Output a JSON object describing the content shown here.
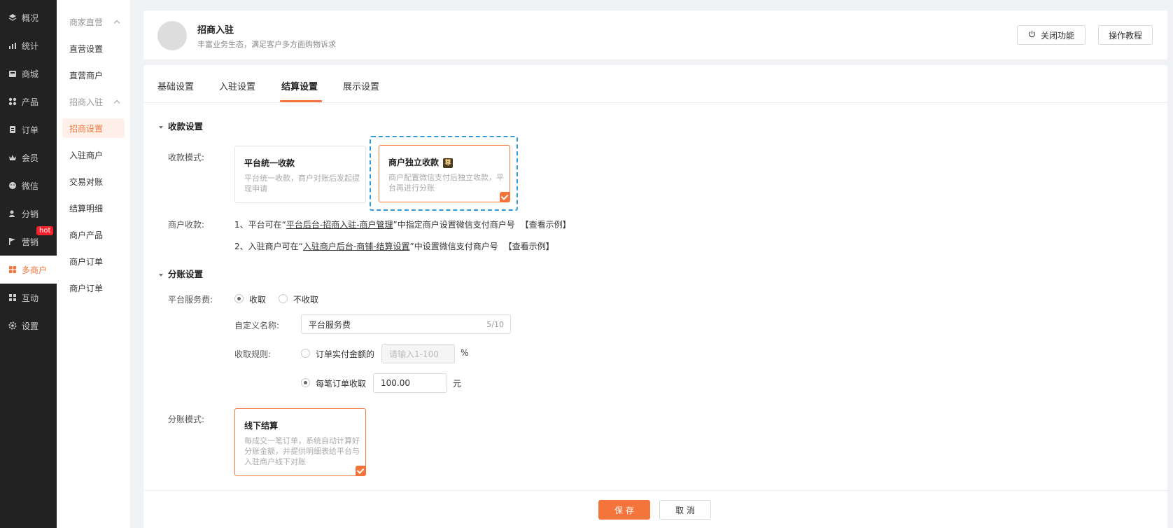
{
  "nav": {
    "items": [
      {
        "label": "概况",
        "icon": "layers-icon"
      },
      {
        "label": "统计",
        "icon": "chart-icon"
      },
      {
        "label": "商城",
        "icon": "store-icon"
      },
      {
        "label": "产品",
        "icon": "grid-icon"
      },
      {
        "label": "订单",
        "icon": "clipboard-icon"
      },
      {
        "label": "会员",
        "icon": "crown-icon"
      },
      {
        "label": "微信",
        "icon": "chat-icon"
      },
      {
        "label": "分销",
        "icon": "user-share-icon"
      },
      {
        "label": "营销",
        "icon": "flag-icon",
        "badge": "hot"
      },
      {
        "label": "多商户",
        "icon": "multi-store-icon"
      },
      {
        "label": "互动",
        "icon": "interact-icon"
      },
      {
        "label": "设置",
        "icon": "gear-icon"
      }
    ]
  },
  "submenu": {
    "group1": "商家直营",
    "group1_items": [
      "直营设置",
      "直营商户"
    ],
    "group2": "招商入驻",
    "group2_items": [
      "招商设置",
      "入驻商户",
      "交易对账",
      "结算明细",
      "商户产品",
      "商户订单",
      "商户订单"
    ]
  },
  "header": {
    "title": "招商入驻",
    "subtitle": "丰富业务生态，满足客户多方面购物诉求",
    "power_button": "关闭功能",
    "tutorial_button": "操作教程"
  },
  "tabs": [
    "基础设置",
    "入驻设置",
    "结算设置",
    "展示设置"
  ],
  "collect": {
    "section_title": "收款设置",
    "mode_label": "收款模式:",
    "card1_title": "平台统一收款",
    "card1_desc": "平台统一收款，商户对账后发起提现申请",
    "card2_title": "商户独立收款",
    "card2_badge": "尊",
    "card2_desc": "商户配置微信支付后独立收款，平台再进行分账",
    "merchant_label": "商户收款:",
    "line1_prefix": "1、平台可在“",
    "line1_link": "平台后台-招商入驻-商户管理",
    "line1_suffix": "”中指定商户设置微信支付商户号",
    "line1_example": "【查看示例】",
    "line2_prefix": "2、入驻商户可在“",
    "line2_link": "入驻商户后台-商铺-结算设置",
    "line2_suffix": "”中设置微信支付商户号",
    "line2_example": "【查看示例】"
  },
  "split": {
    "section_title": "分账设置",
    "fee_label": "平台服务费:",
    "opt_collect": "收取",
    "opt_no_collect": "不收取",
    "custom_name_label": "自定义名称:",
    "custom_name_value": "平台服务费",
    "custom_name_counter": "5/10",
    "rule_label": "收取规则:",
    "rule_opt1": "订单实付金额的",
    "rule_opt1_placeholder": "请输入1-100",
    "rule_opt1_unit": "%",
    "rule_opt2": "每笔订单收取",
    "rule_opt2_value": "100.00",
    "rule_opt2_unit": "元",
    "mode_label": "分账模式:",
    "offline_title": "线下结算",
    "offline_desc": "每成交一笔订单，系统自动计算好分账金额，并提供明细表给平台与入驻商户线下对账"
  },
  "footer": {
    "save": "保 存",
    "cancel": "取 消"
  },
  "colors": {
    "accent": "#f5743b",
    "nav_bg": "#222222",
    "dashed_focus": "#2f9bd8"
  }
}
